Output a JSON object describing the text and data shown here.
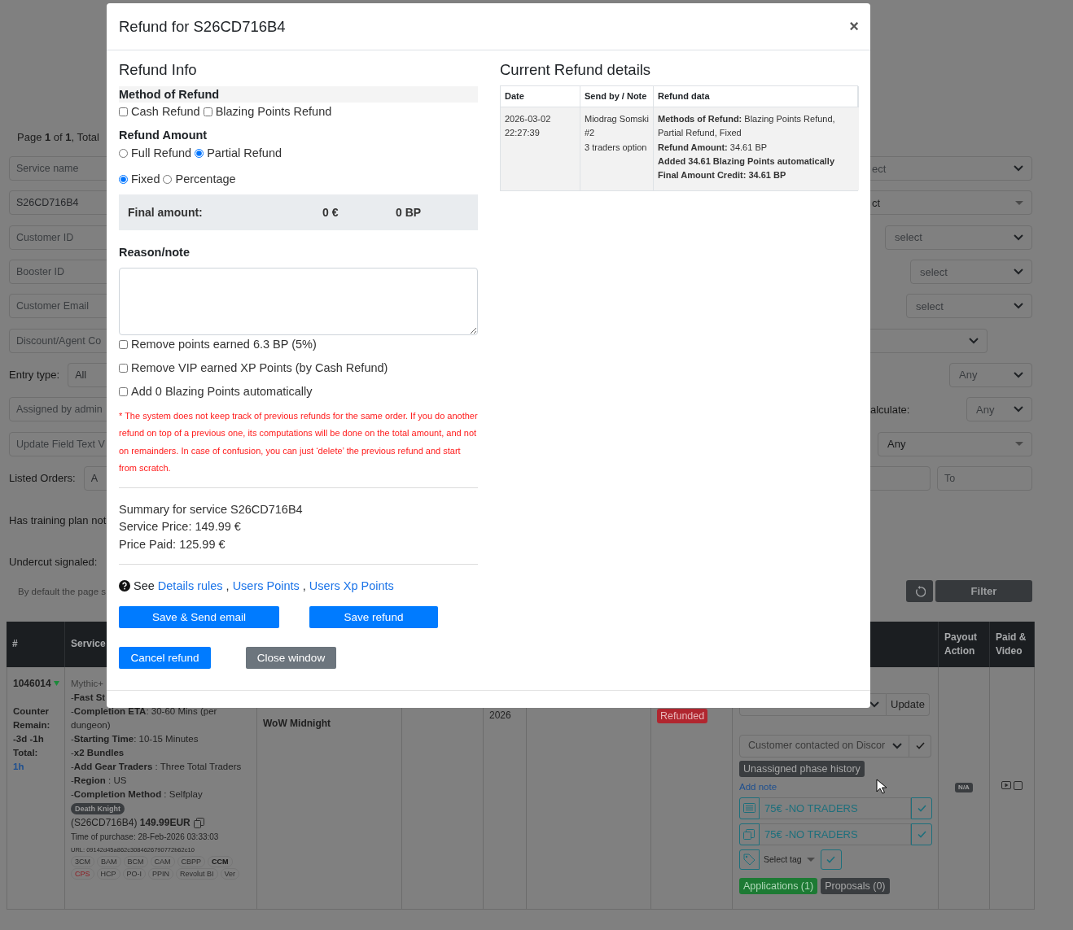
{
  "background": {
    "pagination": "Page **1** of **1**, Total",
    "filter_rows": [
      {
        "left": {
          "kind": "field",
          "placeholder": "Service name"
        },
        "right": {
          "kind": "select",
          "value": "ect"
        }
      },
      {
        "left": {
          "kind": "field",
          "value": "S26CD716B4"
        },
        "right": {
          "kind": "combobox",
          "value": "ct"
        }
      },
      {
        "left": {
          "kind": "field",
          "placeholder": "Customer ID"
        },
        "right": {
          "kind": "select",
          "value": "select"
        }
      },
      {
        "left": {
          "kind": "field",
          "placeholder": "Booster ID"
        },
        "right": {
          "kind": "select",
          "value": "select"
        }
      },
      {
        "left": {
          "kind": "field",
          "placeholder": "Customer Email"
        },
        "right": {
          "kind": "select",
          "value": "select"
        }
      },
      {
        "left": {
          "kind": "field",
          "placeholder": "Discount/Agent Co"
        },
        "right": {
          "kind": "select"
        }
      },
      {
        "left": {
          "kind": "labeled",
          "label": "Entry type:",
          "value": "All"
        },
        "right": {
          "kind": "select",
          "value": "Any"
        }
      },
      {
        "left": {
          "kind": "field",
          "placeholder": "Assigned by admin"
        },
        "right": {
          "kind": "labeled_select",
          "label": "alculate:",
          "value": "Any"
        }
      },
      {
        "left": {
          "kind": "field",
          "placeholder": "Update Field Text V"
        },
        "right": {
          "kind": "combobox",
          "value": "Any"
        }
      },
      {
        "left": {
          "kind": "labeled",
          "label": "Listed Orders:",
          "value": "A"
        },
        "right": {
          "kind": "range",
          "to_placeholder": "To"
        }
      },
      {
        "left": {
          "kind": "label",
          "label": "Has training plan not"
        }
      },
      {
        "left": {
          "kind": "label",
          "label": "Undercut signaled:"
        }
      },
      {
        "left": {
          "kind": "note",
          "label": "By default the page s"
        },
        "right": {
          "kind": "actions",
          "button": "Filter"
        }
      }
    ]
  },
  "orders_table": {
    "columns": [
      {
        "label": "#"
      },
      {
        "label": "Service"
      },
      {
        "label": "Payout Action"
      },
      {
        "label": "Paid & Video"
      }
    ],
    "rows": [
      {
        "id": "1046014",
        "counter": [
          "Counter",
          "Remain:",
          "-3d -1h",
          "Total:"
        ],
        "total": "1h",
        "service": {
          "title": "Mythic+",
          "lines": [
            "-**Fast St**",
            "-**Completion ETA**: 30-60 Mins (per dungeon)",
            "-**Starting Time**: 10-15 Minutes",
            "-**x2 Bundles**",
            "-**Add Gear Traders** : Three Total Traders",
            "-**Region** : US",
            "-**Completion Method** : Selfplay"
          ],
          "class_badge": "Death Knight",
          "price_line": "(S26CD716B4) **149.99EUR**",
          "purchase_time": "Time of purchase: 28-Feb-2026 03:33:03",
          "url": "URL: 09142d45a862c3084626790772b62c10",
          "tags": [
            {
              "label": "3CM",
              "kind": "normal"
            },
            {
              "label": "BAM",
              "kind": "normal"
            },
            {
              "label": "BCM",
              "kind": "normal"
            },
            {
              "label": "CAM",
              "kind": "normal"
            },
            {
              "label": "CBPP",
              "kind": "normal"
            },
            {
              "label": "CCM",
              "kind": "bold"
            },
            {
              "label": "CPS",
              "kind": "alert"
            },
            {
              "label": "HCP",
              "kind": "normal"
            },
            {
              "label": "PO-I",
              "kind": "normal"
            },
            {
              "label": "PPIN",
              "kind": "normal"
            },
            {
              "label": "Revolut BI",
              "kind": "normal"
            },
            {
              "label": "Ver",
              "kind": "normal"
            }
          ]
        },
        "game": "WoW Midnight",
        "year": "2026",
        "status": "Refunded",
        "actions": {
          "update_button": "Update",
          "contact_status": "Customer contacted on Discor",
          "phase_history": "Unassigned phase history",
          "add_note": "Add note",
          "notes": [
            "75€ -NO TRADERS",
            "75€ -NO TRADERS"
          ],
          "tag_placeholder": "Select tag",
          "applications": "Applications (1)",
          "proposals": "Proposals (0)"
        },
        "payout": "N/A",
        "video_checked": false
      }
    ]
  },
  "modal": {
    "title": "Refund for S26CD716B4",
    "close": "×",
    "info_heading": "Refund Info",
    "method_label": "Method of Refund",
    "method_options": [
      {
        "label": "Cash Refund",
        "checked": false
      },
      {
        "label": "Blazing Points Refund",
        "checked": false
      }
    ],
    "amount_label": "Refund Amount",
    "refund_types": [
      {
        "label": "Full Refund",
        "selected": false
      },
      {
        "label": "Partial Refund",
        "selected": true
      }
    ],
    "value_types": [
      {
        "label": "Fixed",
        "selected": true
      },
      {
        "label": "Percentage",
        "selected": false
      }
    ],
    "final_amount": {
      "label": "Final amount:",
      "euro": "0 €",
      "points": "0 BP"
    },
    "reason_label": "Reason/note",
    "extra_options": [
      {
        "label": "Remove points earned 6.3 BP (5%)",
        "checked": false
      },
      {
        "label": "Remove VIP earned XP Points (by Cash Refund)",
        "checked": false
      },
      {
        "label": "Add 0 Blazing Points automatically",
        "checked": false
      }
    ],
    "warning": "* The system does not keep track of previous refunds for the same order. If you do another refund on top of a previous one, its computations will be done on the total amount, and not on remainders. In case of confusion, you can just ‘delete’ the previous refund and start from scratch.",
    "summary": [
      "Summary for service S26CD716B4",
      "Service Price: 149.99 €",
      "Price Paid: 125.99 €"
    ],
    "help": [
      {
        "kind": "text",
        "text": "See"
      },
      {
        "kind": "link",
        "text": "Details rules"
      },
      {
        "kind": "text",
        "text": ","
      },
      {
        "kind": "link",
        "text": "Users Points"
      },
      {
        "kind": "text",
        "text": ","
      },
      {
        "kind": "link",
        "text": "Users Xp Points"
      }
    ],
    "buttons": [
      {
        "label": "Save & Send email",
        "kind": "primary"
      },
      {
        "label": "Save refund",
        "kind": "primary"
      },
      {
        "label": "Cancel refund",
        "kind": "primary"
      },
      {
        "label": "Close window",
        "kind": "secondary"
      }
    ],
    "details": {
      "heading": "Current Refund details",
      "columns": [
        "Date",
        "Send by / Note",
        "Refund data"
      ],
      "rows": [
        {
          "date": "2026-03-02 22:27:39",
          "sender": "Miodrag Somski #2",
          "note": "3 traders option",
          "data": [
            {
              "text": "**Methods of Refund:** Blazing Points Refund, Partial Refund, Fixed",
              "bold": false
            },
            {
              "text": "**Refund Amount:** 34.61 BP",
              "bold": false
            },
            {
              "text": "Added 34.61 Blazing Points automatically",
              "bold": true
            },
            {
              "text": "Final Amount Credit: 34.61 BP",
              "bold": true
            }
          ]
        }
      ]
    }
  }
}
